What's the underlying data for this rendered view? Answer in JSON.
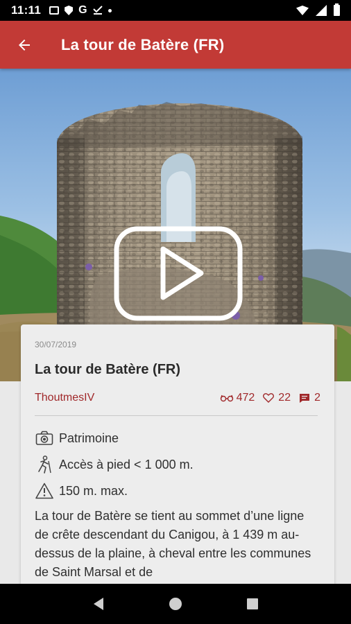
{
  "status_bar": {
    "time": "11:11",
    "icons_left": [
      "gallery-icon",
      "shield-icon",
      "google-icon",
      "download-done-icon",
      "dot-icon"
    ],
    "icons_right": [
      "wifi-icon",
      "signal-icon",
      "battery-icon"
    ]
  },
  "app_bar": {
    "title": "La tour de Batère (FR)",
    "back_icon": "arrow-back-icon",
    "color": "#c23a36"
  },
  "hero": {
    "play_icon": "play-video-icon"
  },
  "card": {
    "date": "30/07/2019",
    "title": "La tour de Batère (FR)",
    "author": "ThoutmesIV",
    "stats": {
      "views": "472",
      "likes": "22",
      "comments": "2"
    },
    "info": [
      {
        "icon": "camera-icon",
        "text": "Patrimoine"
      },
      {
        "icon": "hiker-icon",
        "text": "Accès à pied < 1 000 m."
      },
      {
        "icon": "warning-icon",
        "text": "150 m. max."
      }
    ],
    "description": "La tour de Batère se tient au sommet d’une ligne de crête descendant du Canigou, à 1 439 m au-dessus de la plaine, à cheval entre les communes de Saint Marsal et de"
  },
  "accent_color": "#a0282a",
  "nav_bar": {
    "icons": [
      "back-triangle-icon",
      "home-circle-icon",
      "recents-square-icon"
    ]
  }
}
